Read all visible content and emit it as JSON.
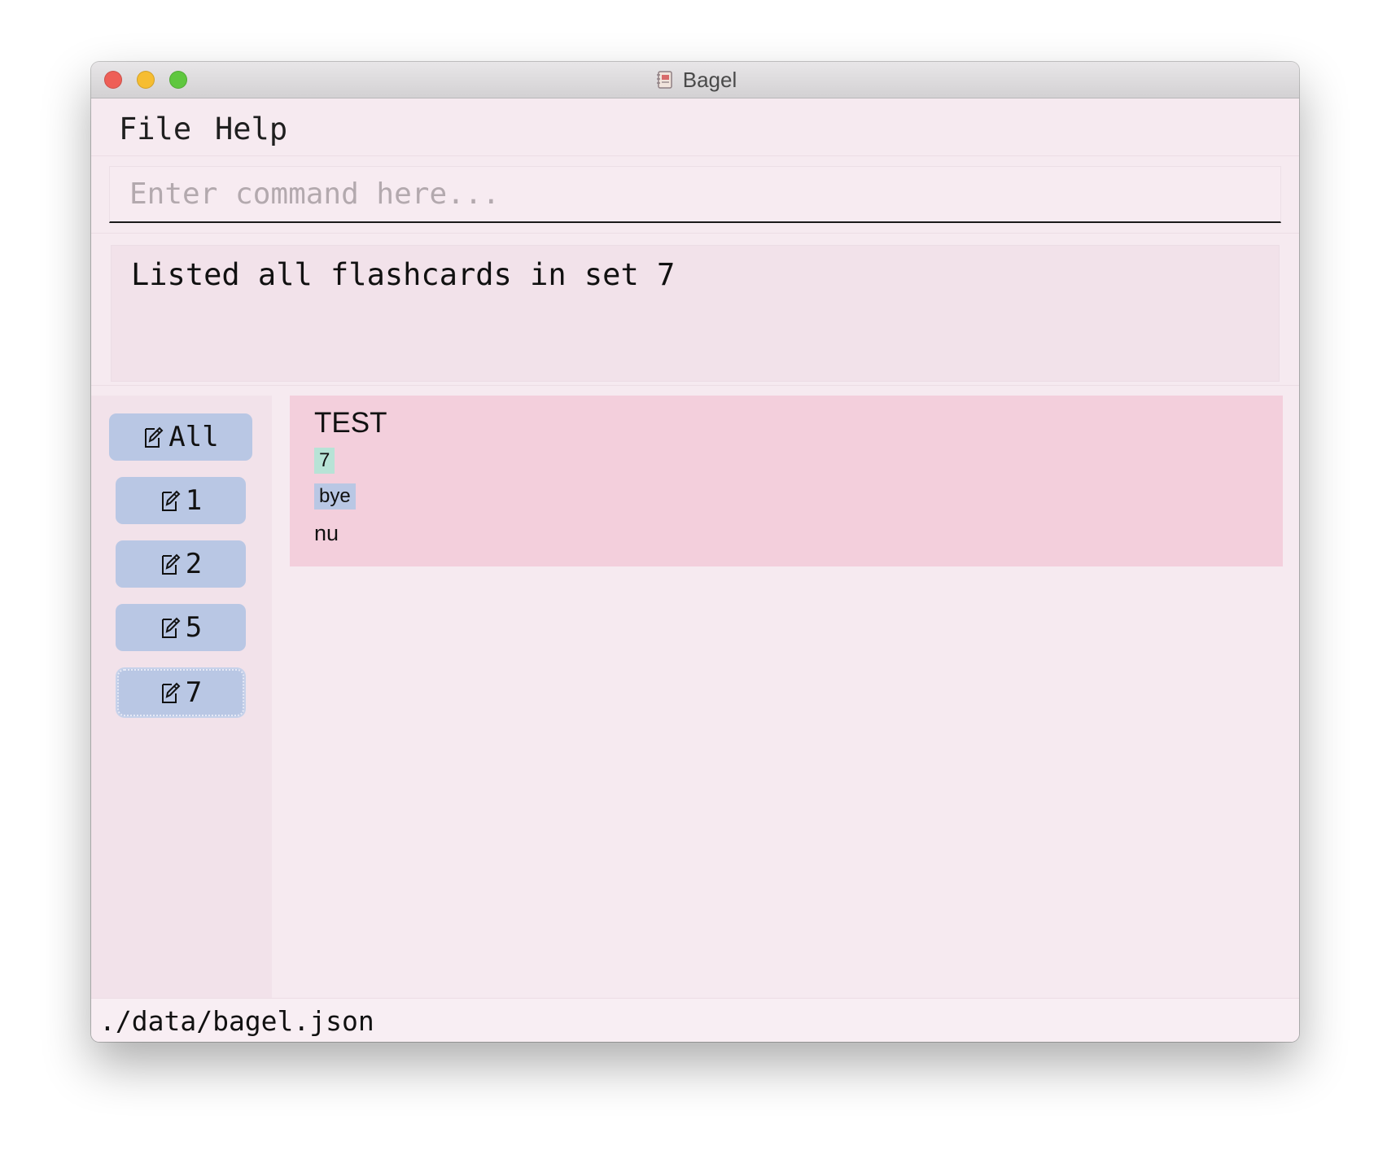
{
  "window": {
    "title": "Bagel",
    "app_icon": "notebook-icon"
  },
  "menu": {
    "items": [
      "File",
      "Help"
    ]
  },
  "command": {
    "value": "",
    "placeholder": "Enter command here..."
  },
  "result": {
    "message": "Listed all flashcards in set 7"
  },
  "sidebar": {
    "icon": "edit-icon",
    "sets": [
      {
        "label": "All"
      },
      {
        "label": "1"
      },
      {
        "label": "2"
      },
      {
        "label": "5"
      },
      {
        "label": "7",
        "focused": true
      }
    ]
  },
  "cards": [
    {
      "title": "TEST",
      "set_tag": "7",
      "tag": "bye",
      "answer": "nu"
    }
  ],
  "status": {
    "file_path": "./data/bagel.json"
  },
  "colors": {
    "window_bg": "#f6eaf0",
    "panel_bg": "#f2e2ea",
    "card_bg": "#f3cfdc",
    "button_bg": "#b9c7e4",
    "set_tag_bg": "#b7e3d6",
    "tag_bg": "#b9c7e4"
  }
}
